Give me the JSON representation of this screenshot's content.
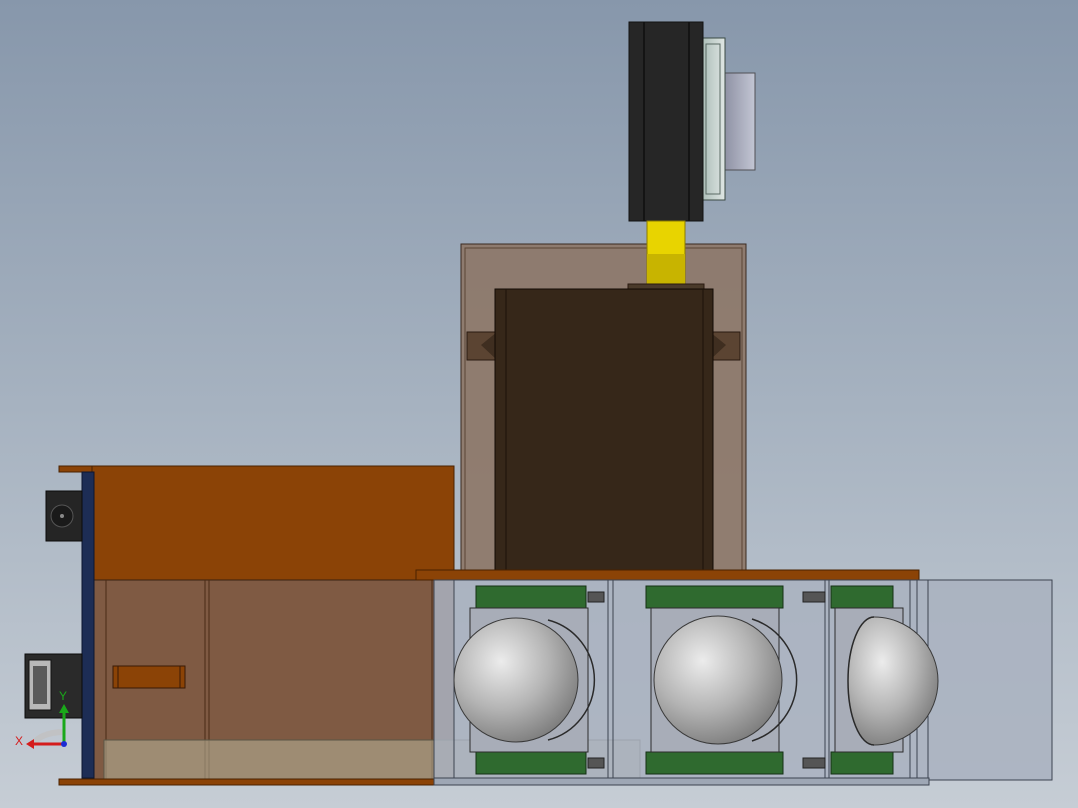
{
  "viewport": {
    "background_top": "#8797ab",
    "background_bottom": "#c6cdd5"
  },
  "colors": {
    "wood": "#8b4306",
    "wood_dark": "#5e2d05",
    "wood_light": "#7f5a43",
    "glass": "#a9b2c0",
    "motor_dark": "#362719",
    "motor_black": "#262626",
    "shaft_yellow": "#e8d400",
    "green_plate": "#2f6a2f",
    "axis_x": "#d41c1c",
    "axis_y": "#1aa81a",
    "axis_z": "#1c2bd4"
  },
  "triad": {
    "x_label": "X",
    "y_label": "Y",
    "x_icon": "axis-x-arrow-icon",
    "y_icon": "axis-y-arrow-icon"
  }
}
